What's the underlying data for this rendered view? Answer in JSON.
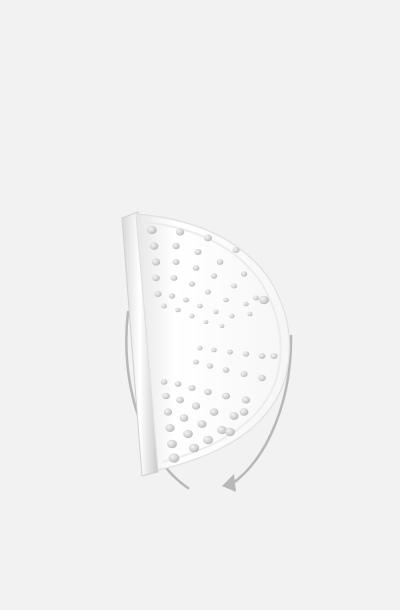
{
  "scene": {
    "background": "#f2f2f2",
    "object_icon": "perforated-half-disc-icon",
    "rotation_icon": "rotate-arrow-icon",
    "arrow_color": "#b8b8b8",
    "disc_color": "#ffffff"
  }
}
